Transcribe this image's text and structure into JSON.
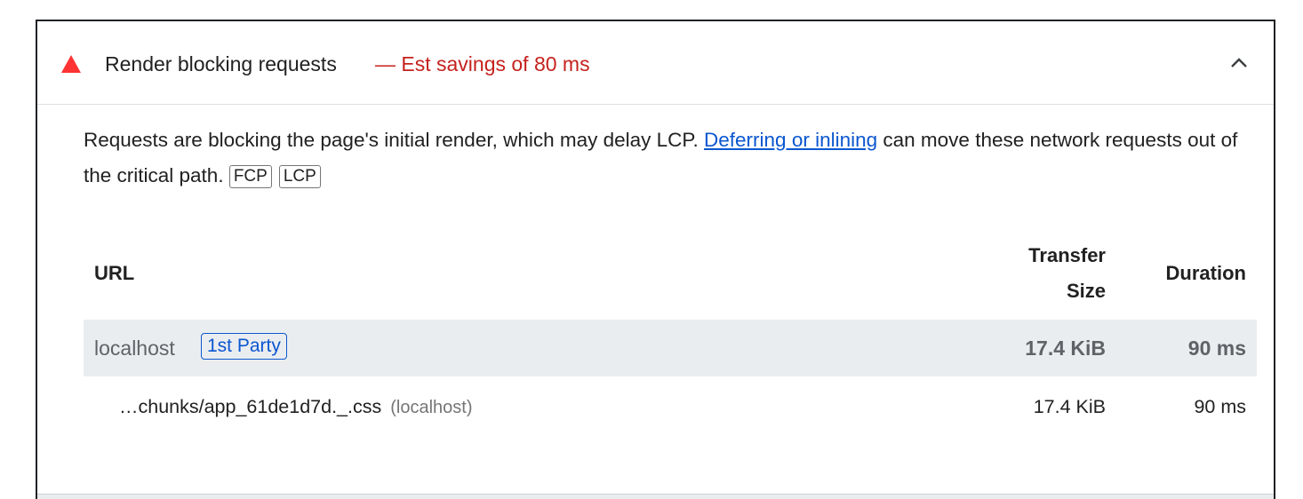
{
  "audit": {
    "title": "Render blocking requests",
    "savings": "— Est savings of 80 ms",
    "status_color": "#ff3333",
    "description_before": "Requests are blocking the page's initial render, which may delay LCP. ",
    "link_text": "Deferring or inlining",
    "description_after": " can move these network requests out of the critical path. ",
    "tags": [
      "FCP",
      "LCP"
    ]
  },
  "table": {
    "headers": {
      "url": "URL",
      "size_line1": "Transfer",
      "size_line2": "Size",
      "duration": "Duration"
    },
    "group": {
      "url": "localhost",
      "badge": "1st Party",
      "size": "17.4 KiB",
      "duration": "90 ms"
    },
    "items": [
      {
        "url": "…chunks/app_61de1d7d._.css",
        "host": "(localhost)",
        "size": "17.4 KiB",
        "duration": "90 ms"
      }
    ]
  },
  "icons": {
    "status": "warning-triangle-icon",
    "toggle": "chevron-up-icon"
  }
}
